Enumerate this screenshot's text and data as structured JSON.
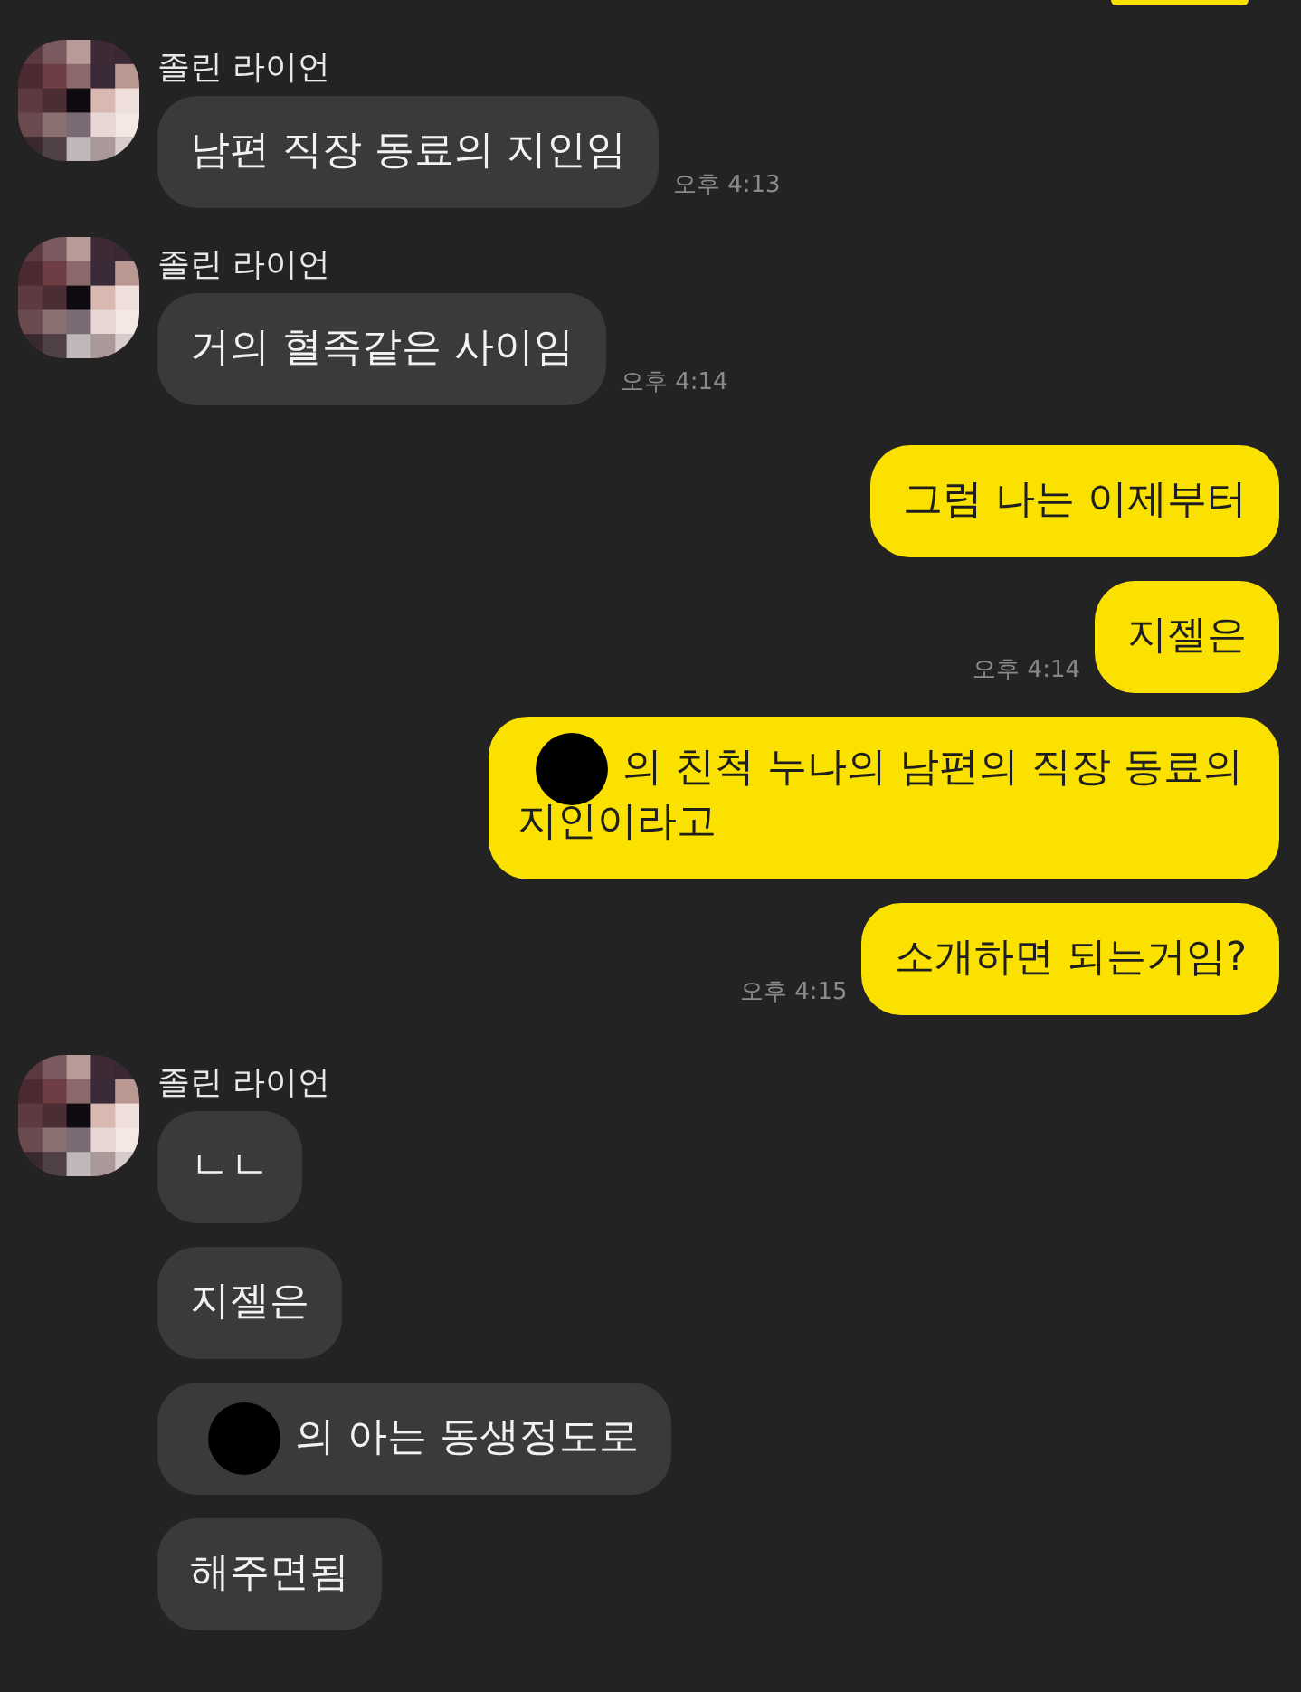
{
  "groups": [
    {
      "kind": "received",
      "name": "졸린 라이언",
      "messages": [
        {
          "kind": "text",
          "text": "남편 직장 동료의 지인임",
          "time": "오후 4:13"
        }
      ]
    },
    {
      "kind": "received",
      "name": "졸린 라이언",
      "messages": [
        {
          "kind": "text",
          "text": "거의 혈족같은 사이임",
          "time": "오후 4:14"
        }
      ]
    },
    {
      "kind": "sent",
      "messages": [
        {
          "kind": "text",
          "text": "그럼 나는 이제부터"
        },
        {
          "kind": "text",
          "text": "지젤은",
          "time": "오후 4:14"
        },
        {
          "kind": "redacted",
          "lines": [
            "의 친척 누나의 남편의 직장 동료의",
            "지인이라고"
          ]
        },
        {
          "kind": "text",
          "text": "소개하면 되는거임?",
          "time": "오후 4:15"
        }
      ]
    },
    {
      "kind": "received",
      "name": "졸린 라이언",
      "messages": [
        {
          "kind": "text",
          "text": "ㄴㄴ"
        },
        {
          "kind": "text",
          "text": "지젤은"
        },
        {
          "kind": "redacted",
          "lines": [
            "의 아는 동생정도로"
          ]
        },
        {
          "kind": "text",
          "text": "해주면됨"
        }
      ]
    }
  ]
}
